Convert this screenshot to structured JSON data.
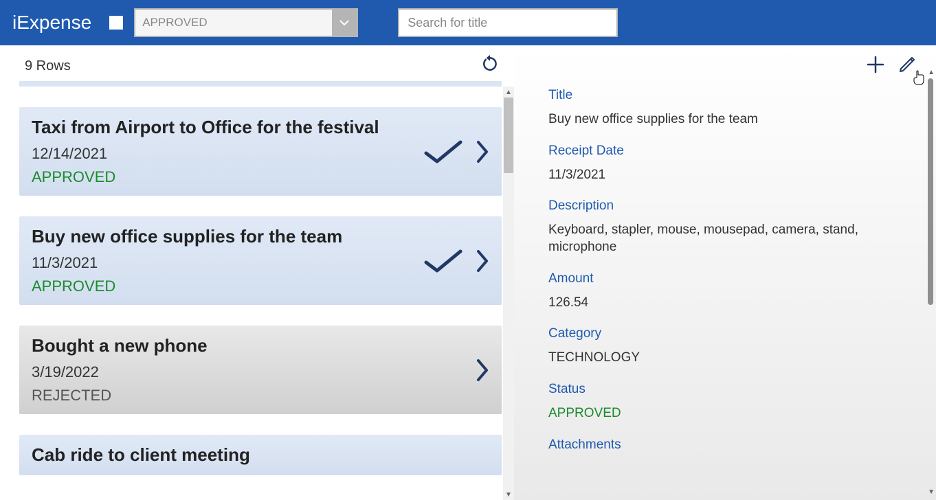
{
  "header": {
    "app_title": "iExpense",
    "filter_value": "APPROVED",
    "search_placeholder": "Search for title"
  },
  "list": {
    "row_count_label": "9 Rows",
    "items": [
      {
        "title": "Taxi from Airport to Office for the festival",
        "date": "12/14/2021",
        "status": "APPROVED",
        "status_class": "approved",
        "has_check": true
      },
      {
        "title": "Buy new office supplies for the team",
        "date": "11/3/2021",
        "status": "APPROVED",
        "status_class": "approved",
        "has_check": true
      },
      {
        "title": "Bought a new phone",
        "date": "3/19/2022",
        "status": "REJECTED",
        "status_class": "rejected",
        "has_check": false
      },
      {
        "title": "Cab ride to client meeting",
        "date": "",
        "status": "",
        "status_class": "approved",
        "has_check": true
      }
    ]
  },
  "detail": {
    "labels": {
      "title": "Title",
      "receipt_date": "Receipt Date",
      "description": "Description",
      "amount": "Amount",
      "category": "Category",
      "status": "Status",
      "attachments": "Attachments"
    },
    "values": {
      "title": "Buy new office supplies for the team",
      "receipt_date": "11/3/2021",
      "description": "Keyboard, stapler, mouse, mousepad, camera, stand, microphone",
      "amount": "126.54",
      "category": "TECHNOLOGY",
      "status": "APPROVED"
    }
  }
}
